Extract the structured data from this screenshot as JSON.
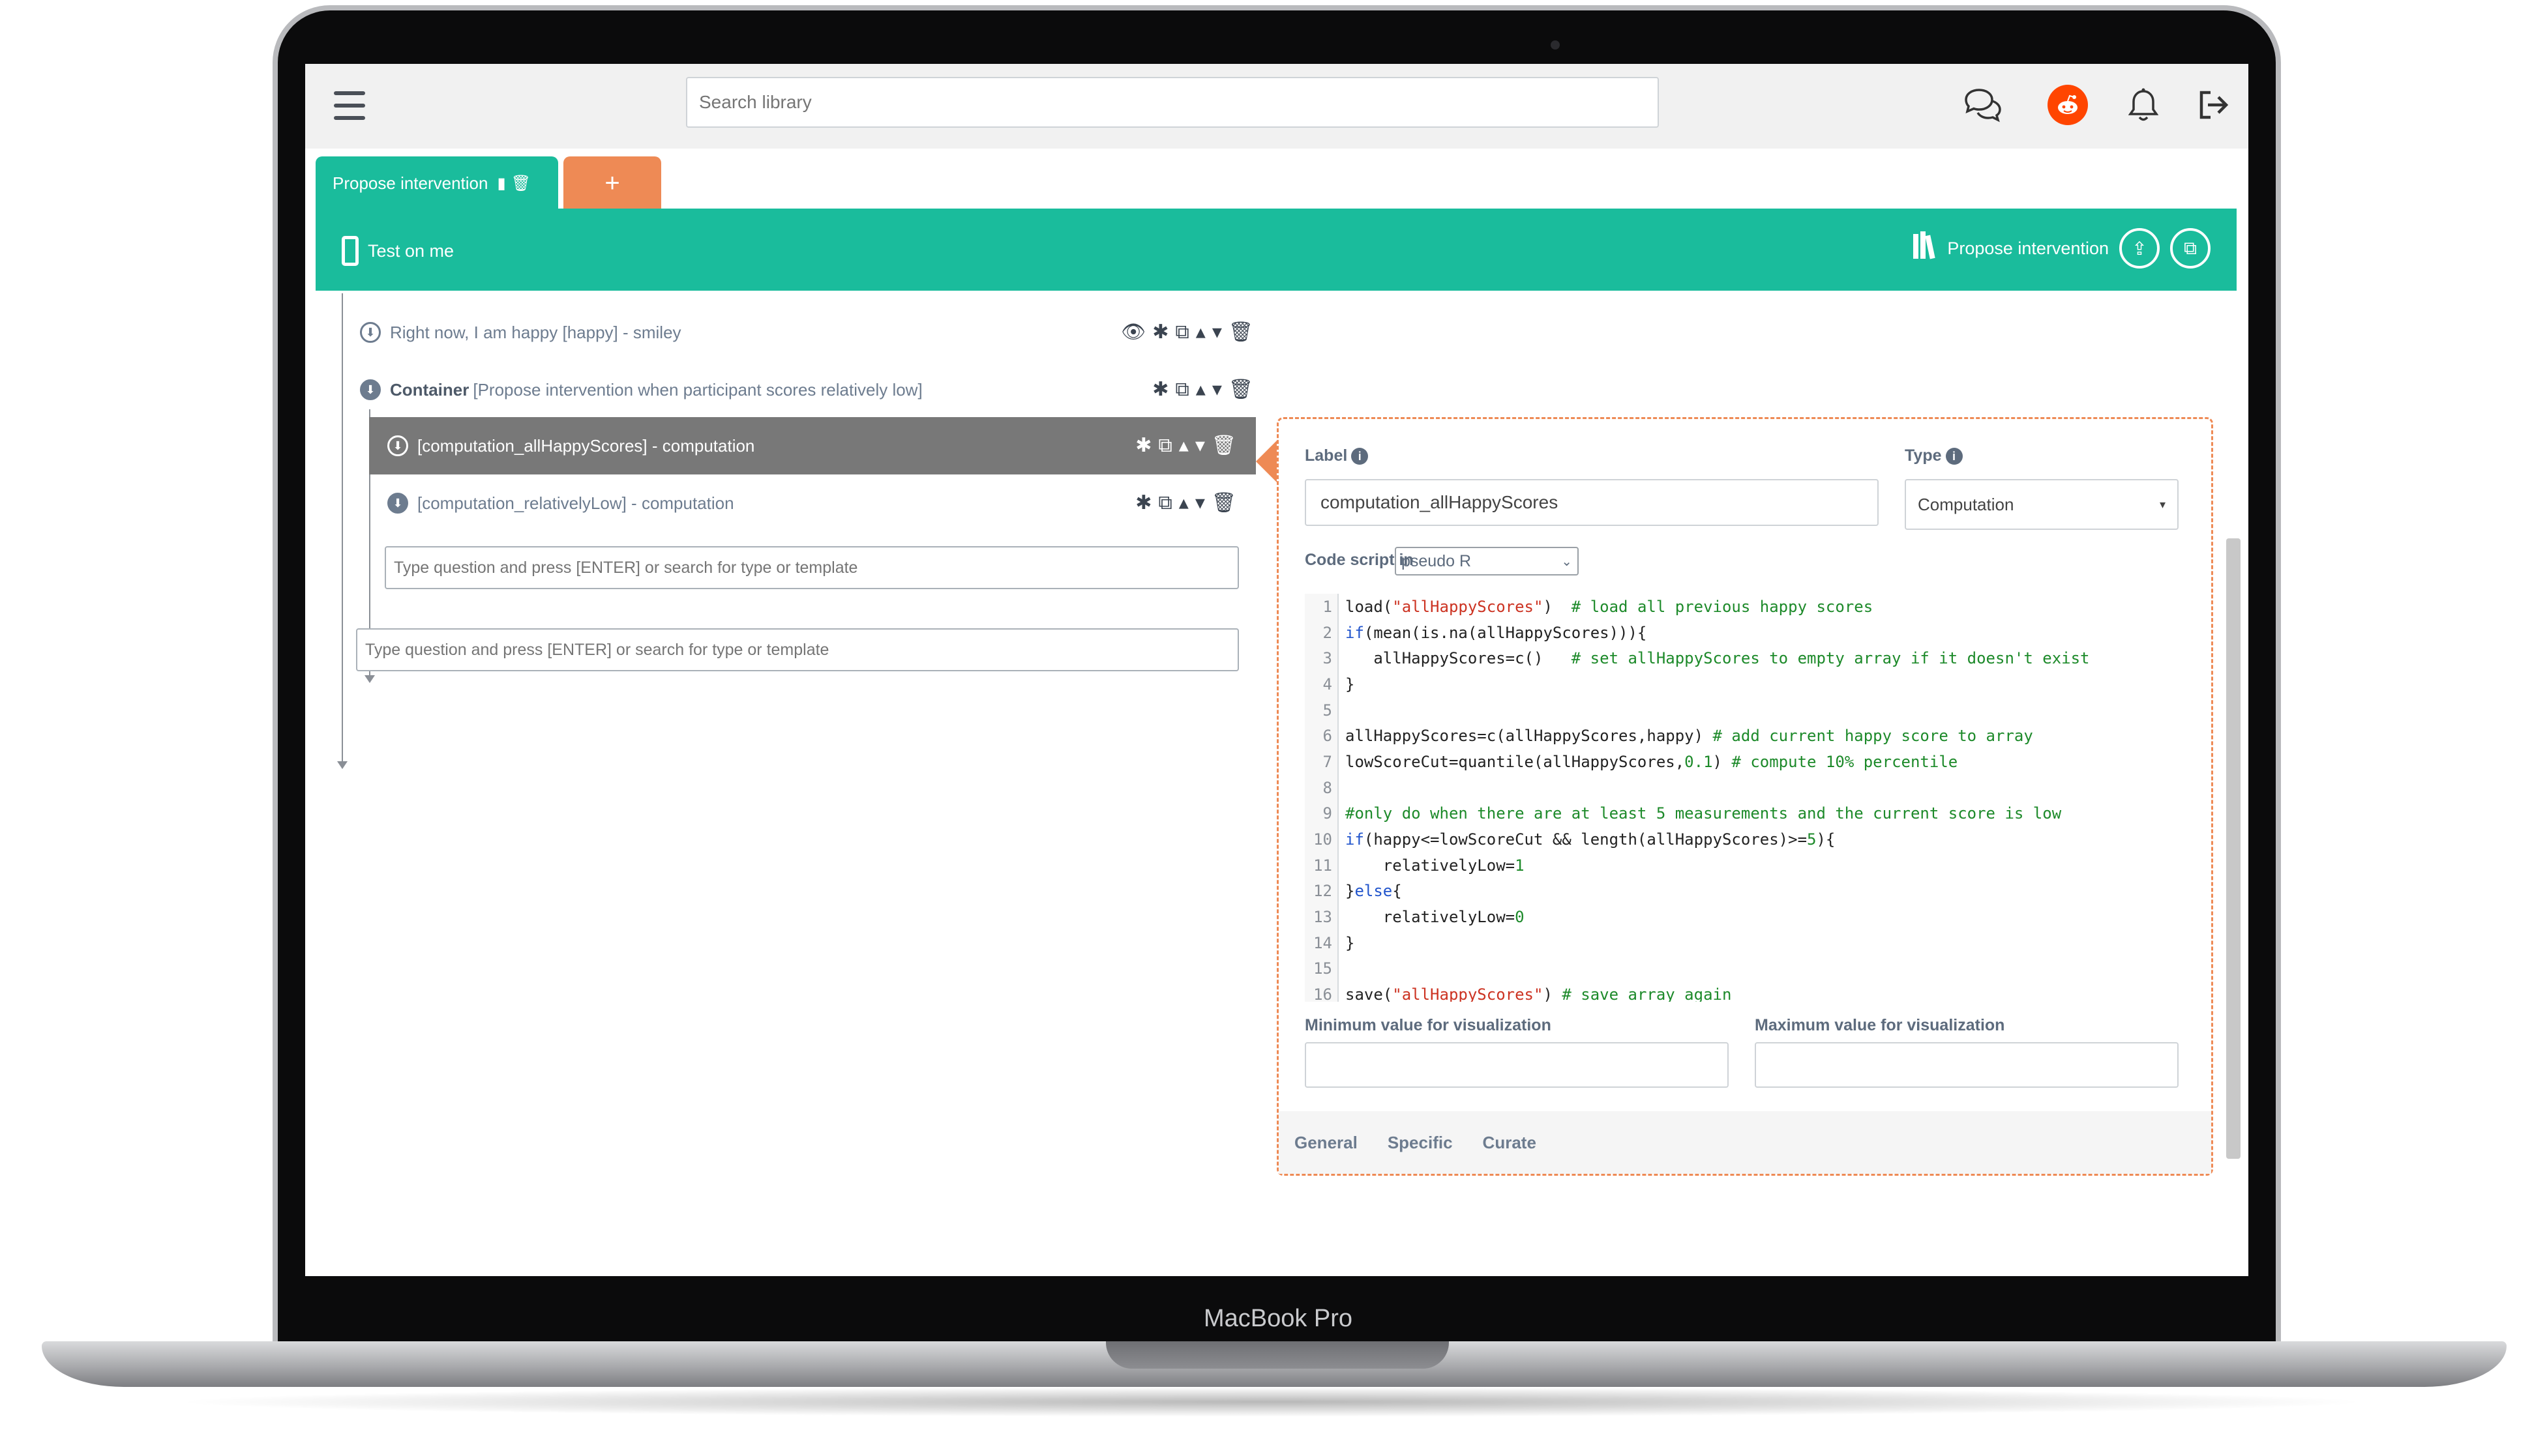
{
  "device": {
    "label": "MacBook Pro"
  },
  "topbar": {
    "search_placeholder": "Search library",
    "icons": [
      "menu-icon",
      "chat-icon",
      "reddit-icon",
      "bell-icon",
      "logout-icon"
    ]
  },
  "tabs": [
    {
      "label": "Propose intervention",
      "active": true
    },
    {
      "label": "+",
      "active": false
    }
  ],
  "banner": {
    "test_label": "Test on me",
    "library_label": "Propose intervention",
    "color": "#1abc9c"
  },
  "tree": {
    "items": [
      {
        "text": "Right now, I am happy [happy] - smiley"
      },
      {
        "bold": "Container",
        "text": "[Propose intervention when participant scores relatively low]"
      },
      {
        "text": "[computation_allHappyScores] - computation",
        "selected": true
      },
      {
        "text": "[computation_relativelyLow] - computation"
      }
    ],
    "inner_input_placeholder": "Type question and press [ENTER] or search for type or template",
    "outer_input_placeholder": "Type question and press [ENTER] or search for type or template"
  },
  "panel": {
    "label_title": "Label",
    "label_value": "computation_allHappyScores",
    "type_title": "Type",
    "type_value": "Computation",
    "code_script_label": "Code script in",
    "code_language": "pseudo R",
    "code_lines": [
      {
        "n": "1",
        "parts": [
          [
            "",
            "load("
          ],
          [
            "str",
            "\"allHappyScores\""
          ],
          [
            "",
            ")  "
          ],
          [
            "cmt",
            "# load all previous happy scores"
          ]
        ]
      },
      {
        "n": "2",
        "parts": [
          [
            "kw",
            "if"
          ],
          [
            "",
            "(mean(is.na(allHappyScores))){"
          ]
        ]
      },
      {
        "n": "3",
        "parts": [
          [
            "",
            "   allHappyScores=c()   "
          ],
          [
            "cmt",
            "# set allHappyScores to empty array if it doesn't exist"
          ]
        ]
      },
      {
        "n": "4",
        "parts": [
          [
            "",
            "}"
          ]
        ]
      },
      {
        "n": "5",
        "parts": [
          [
            "",
            ""
          ]
        ]
      },
      {
        "n": "6",
        "parts": [
          [
            "",
            "allHappyScores=c(allHappyScores,happy) "
          ],
          [
            "cmt",
            "# add current happy score to array"
          ]
        ]
      },
      {
        "n": "7",
        "parts": [
          [
            "",
            "lowScoreCut=quantile(allHappyScores,"
          ],
          [
            "num",
            "0.1"
          ],
          [
            "",
            ") "
          ],
          [
            "cmt",
            "# compute 10% percentile"
          ]
        ]
      },
      {
        "n": "8",
        "parts": [
          [
            "",
            ""
          ]
        ]
      },
      {
        "n": "9",
        "parts": [
          [
            "cmt",
            "#only do when there are at least 5 measurements and the current score is low"
          ]
        ]
      },
      {
        "n": "10",
        "parts": [
          [
            "kw",
            "if"
          ],
          [
            "",
            "(happy<=lowScoreCut && length(allHappyScores)>="
          ],
          [
            "num",
            "5"
          ],
          [
            "",
            "){"
          ]
        ]
      },
      {
        "n": "11",
        "parts": [
          [
            "",
            "    relativelyLow="
          ],
          [
            "num",
            "1"
          ]
        ]
      },
      {
        "n": "12",
        "parts": [
          [
            "",
            "}"
          ],
          [
            "kw",
            "else"
          ],
          [
            "",
            "{"
          ]
        ]
      },
      {
        "n": "13",
        "parts": [
          [
            "",
            "    relativelyLow="
          ],
          [
            "num",
            "0"
          ]
        ]
      },
      {
        "n": "14",
        "parts": [
          [
            "",
            "}"
          ]
        ]
      },
      {
        "n": "15",
        "parts": [
          [
            "",
            ""
          ]
        ]
      },
      {
        "n": "16",
        "parts": [
          [
            "",
            "save("
          ],
          [
            "str",
            "\"allHappyScores\""
          ],
          [
            "",
            ") "
          ],
          [
            "cmt",
            "# save array again"
          ]
        ]
      }
    ],
    "min_label": "Minimum value for visualization",
    "max_label": "Maximum value for visualization",
    "min_value": "",
    "max_value": "",
    "subtabs": [
      "General",
      "Specific",
      "Curate"
    ]
  }
}
